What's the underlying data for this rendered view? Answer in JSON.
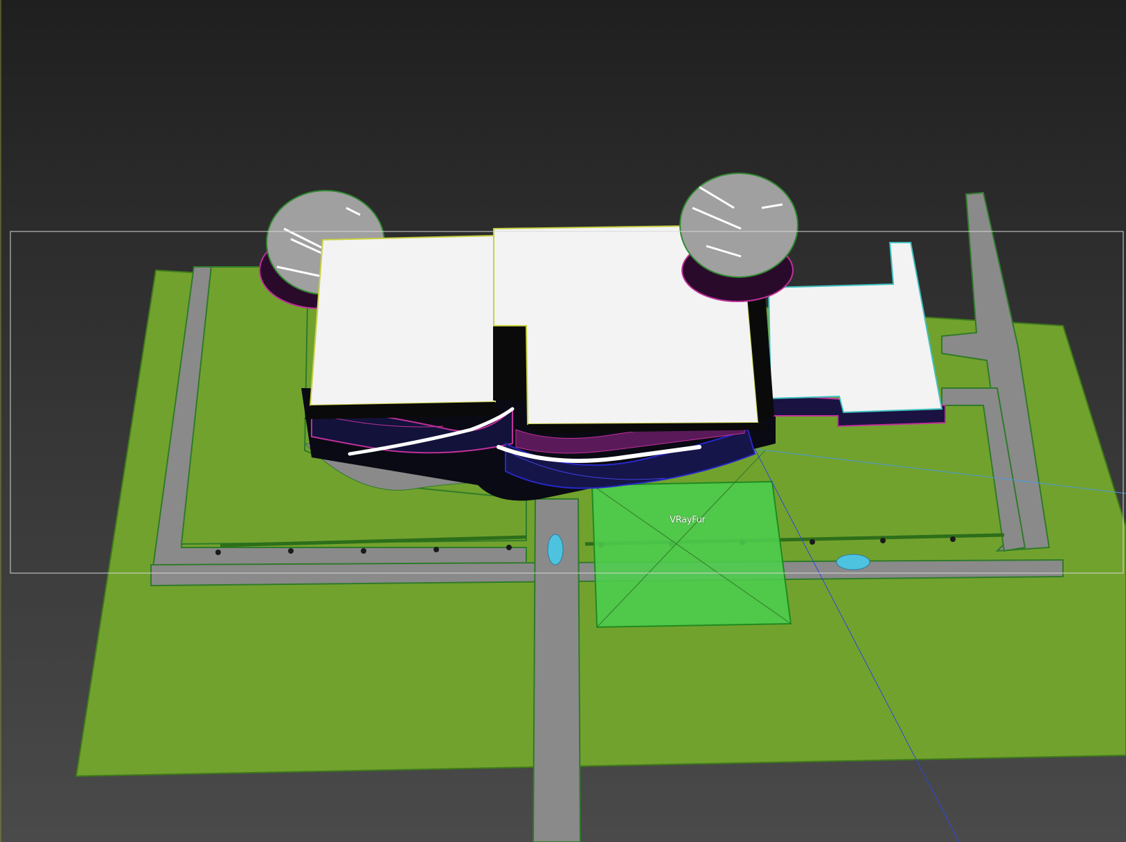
{
  "viewport": {
    "name": "3d-perspective-viewport",
    "selected_object_label": "VRayFur"
  },
  "colors": {
    "background_top": "#1f1f1f",
    "background_bottom": "#4a4a4a",
    "ground_grass": "#72a22e",
    "road": "#8a8a8a",
    "roof": "#f3f3f3",
    "selection_green": "#4ccc4c",
    "wire_magenta": "#c0309a",
    "wire_blue": "#2828c8",
    "water": "#4ec3e0",
    "safe_frame": "#d8d8d8"
  }
}
